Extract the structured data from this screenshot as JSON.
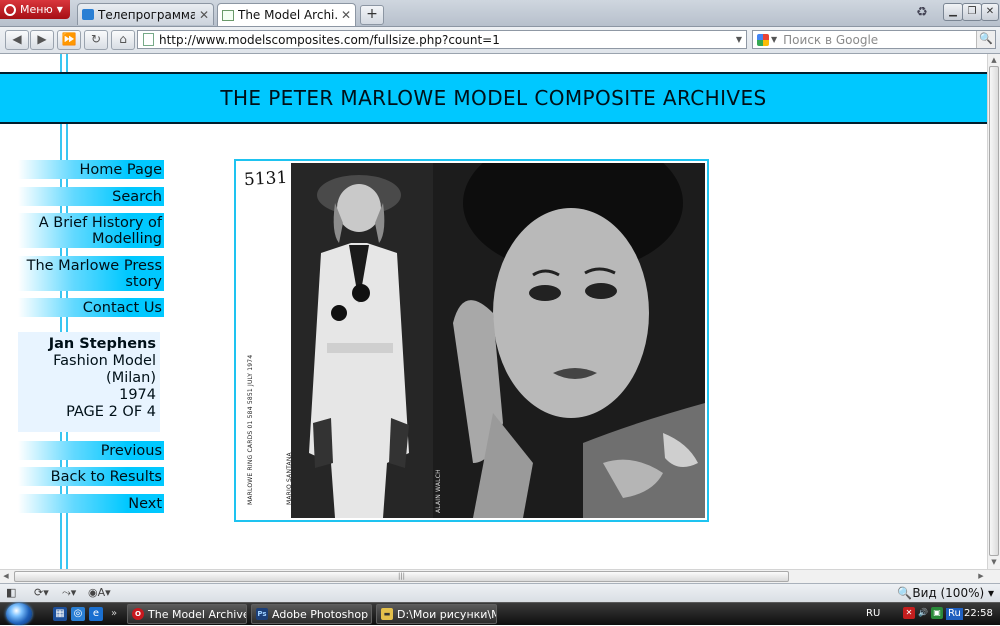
{
  "browser": {
    "menu_label": "Меню",
    "tabs": [
      {
        "label": "Телепрограмма...",
        "active": false
      },
      {
        "label": "The Model Archi...",
        "active": true
      }
    ],
    "new_tab_symbol": "+",
    "url": "http://www.modelscomposites.com/fullsize.php?count=1",
    "search_placeholder": "Поиск в Google",
    "zoom_label": "Вид (100%)"
  },
  "site": {
    "title": "THE PETER MARLOWE MODEL COMPOSITE ARCHIVES",
    "nav": [
      {
        "label": "Home Page"
      },
      {
        "label": "Search"
      },
      {
        "label": "A Brief History of Modelling"
      },
      {
        "label": "The Marlowe Press story"
      },
      {
        "label": "Contact Us"
      }
    ],
    "model": {
      "name": "Jan Stephens",
      "category": "Fashion Model",
      "location": "(Milan)",
      "year": "1974",
      "page": "PAGE 2 OF 4"
    },
    "pager": {
      "previous": "Previous",
      "back": "Back to Results",
      "next": "Next"
    },
    "composite": {
      "ref_number": "5131",
      "credit_printer": "MARLOWE RING CARDS 01 584 5851 JULY 1974",
      "credit_left": "MARIO SANTANA",
      "credit_right": "ALAIN WALCH"
    }
  },
  "taskbar": {
    "items": [
      {
        "label": "The Model Archives..."
      },
      {
        "label": "Adobe Photoshop ..."
      },
      {
        "label": "D:\\Мои рисунки\\М..."
      }
    ],
    "lang": "RU",
    "lang2": "Ru",
    "clock": "22:58"
  }
}
